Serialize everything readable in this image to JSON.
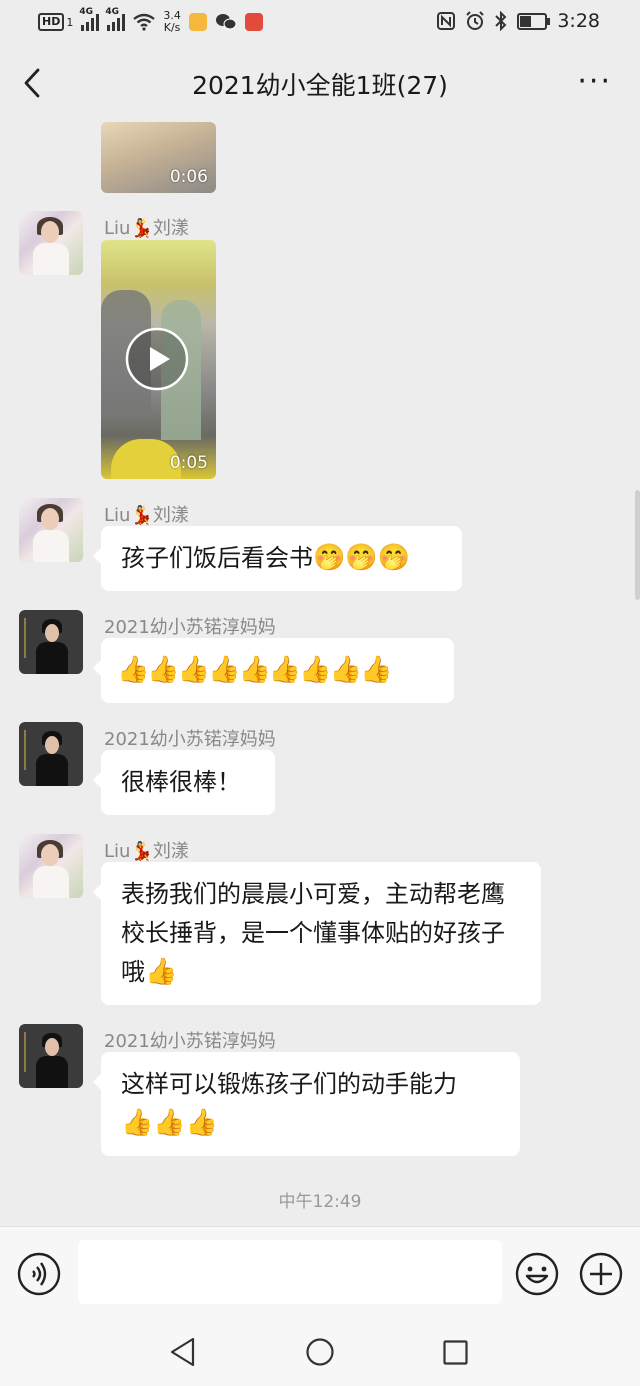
{
  "status_bar": {
    "hd": "HD",
    "sim1": "1",
    "net1": "4G",
    "net2": "4G",
    "speed_value": "3.4",
    "speed_unit": "K/s",
    "time": "3:28",
    "icons": [
      "hd-icon",
      "signal-icon",
      "wifi-icon",
      "notification-app-icon",
      "wechat-icon",
      "app-icon",
      "nfc-icon",
      "alarm-icon",
      "bluetooth-icon",
      "battery-icon"
    ]
  },
  "nav": {
    "title": "2021幼小全能1班(27)",
    "more_label": "···"
  },
  "messages": [
    {
      "type": "video",
      "sender": "",
      "duration": "0:06"
    },
    {
      "type": "video",
      "sender": "Liu💃刘漾",
      "duration": "0:05"
    },
    {
      "type": "text",
      "sender": "Liu💃刘漾",
      "text": "孩子们饭后看会书",
      "emoji": "🤭🤭🤭"
    },
    {
      "type": "text",
      "sender": "2021幼小苏锘淳妈妈",
      "text": "",
      "emoji": "👍👍👍👍👍👍👍👍👍"
    },
    {
      "type": "text",
      "sender": "2021幼小苏锘淳妈妈",
      "text": "很棒很棒！",
      "emoji": ""
    },
    {
      "type": "text",
      "sender": "Liu💃刘漾",
      "text": "表扬我们的晨晨小可爱，主动帮老鹰校长捶背，是一个懂事体贴的好孩子哦",
      "emoji": "👍"
    },
    {
      "type": "text",
      "sender": "2021幼小苏锘淳妈妈",
      "text": "这样可以锻炼孩子们的动手能力",
      "emoji": "👍👍👍"
    }
  ],
  "timestamp": "中午12:49",
  "input": {
    "value": "",
    "placeholder": ""
  },
  "colors": {
    "background": "#ededed",
    "bubble": "#ffffff",
    "sender": "#888888"
  }
}
